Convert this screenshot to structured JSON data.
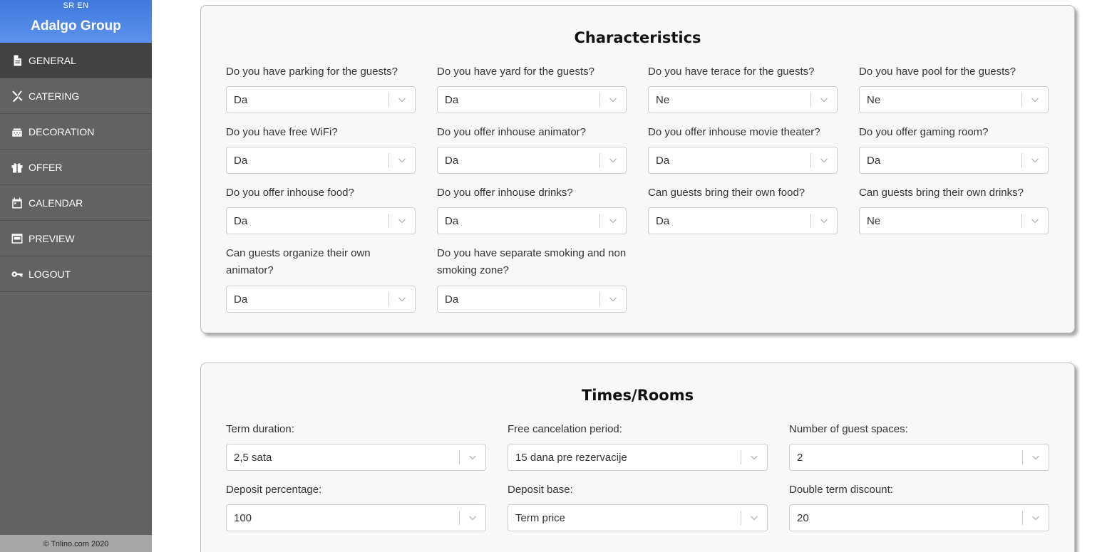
{
  "sidebar": {
    "lang_sr": "SR",
    "lang_en": "EN",
    "brand": "Adalgo Group",
    "items": [
      {
        "label": "GENERAL",
        "icon": "document-icon"
      },
      {
        "label": "CATERING",
        "icon": "utensils-icon"
      },
      {
        "label": "DECORATION",
        "icon": "cake-icon"
      },
      {
        "label": "OFFER",
        "icon": "gift-icon"
      },
      {
        "label": "CALENDAR",
        "icon": "calendar-icon"
      },
      {
        "label": "PREVIEW",
        "icon": "window-icon"
      },
      {
        "label": "LOGOUT",
        "icon": "key-icon"
      }
    ],
    "active": "GENERAL",
    "footer": "© Trilino.com 2020"
  },
  "characteristics": {
    "title": "Characteristics",
    "fields": [
      {
        "label": "Do you have parking for the guests?",
        "value": "Da"
      },
      {
        "label": "Do you have yard for the guests?",
        "value": "Da"
      },
      {
        "label": "Do you have terace for the guests?",
        "value": "Ne"
      },
      {
        "label": "Do you have pool for the guests?",
        "value": "Ne"
      },
      {
        "label": "Do you have free WiFi?",
        "value": "Da"
      },
      {
        "label": "Do you offer inhouse animator?",
        "value": "Da"
      },
      {
        "label": "Do you offer inhouse movie theater?",
        "value": "Da"
      },
      {
        "label": "Do you offer gaming room?",
        "value": "Da"
      },
      {
        "label": "Do you offer inhouse food?",
        "value": "Da"
      },
      {
        "label": "Do you offer inhouse drinks?",
        "value": "Da"
      },
      {
        "label": "Can guests bring their own food?",
        "value": "Da"
      },
      {
        "label": "Can guests bring their own drinks?",
        "value": "Ne"
      },
      {
        "label": "Can guests organize their own animator?",
        "value": "Da"
      },
      {
        "label": "Do you have separate smoking and non smoking zone?",
        "value": "Da"
      }
    ]
  },
  "times": {
    "title": "Times/Rooms",
    "fields": [
      {
        "label": "Term duration:",
        "value": "2,5 sata"
      },
      {
        "label": "Free cancelation period:",
        "value": "15 dana pre rezervacije"
      },
      {
        "label": "Number of guest spaces:",
        "value": "2"
      },
      {
        "label": "Deposit percentage:",
        "value": "100"
      },
      {
        "label": "Deposit base:",
        "value": "Term price"
      },
      {
        "label": "Double term discount:",
        "value": "20"
      }
    ]
  }
}
